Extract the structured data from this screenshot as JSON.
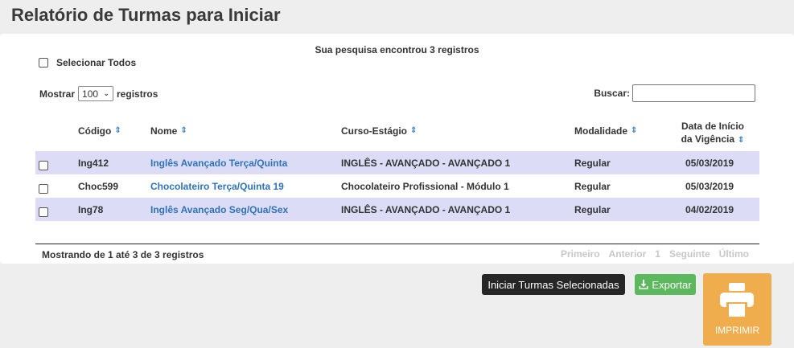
{
  "page": {
    "title": "Relatório de Turmas para Iniciar"
  },
  "summary": {
    "result_text": "Sua pesquisa encontrou 3 registros"
  },
  "select_all": {
    "label": "Selecionar Todos"
  },
  "length": {
    "prefix": "Mostrar",
    "value": "100",
    "suffix": "registros"
  },
  "search": {
    "label": "Buscar:",
    "value": ""
  },
  "table": {
    "headers": {
      "codigo": "Código",
      "nome": "Nome",
      "curso": "Curso-Estágio",
      "modalidade": "Modalidade",
      "data_line1": "Data de Início",
      "data_line2": "da Vigência"
    },
    "rows": [
      {
        "codigo": "Ing412",
        "nome": "Inglês Avançado Terça/Quinta",
        "curso": "INGLÊS - AVANÇADO - AVANÇADO 1",
        "modalidade": "Regular",
        "data": "05/03/2019"
      },
      {
        "codigo": "Choc599",
        "nome": "Chocolateiro Terça/Quinta 19",
        "curso": "Chocolateiro Profissional - Módulo 1",
        "modalidade": "Regular",
        "data": "05/03/2019"
      },
      {
        "codigo": "Ing78",
        "nome": "Inglês Avançado Seg/Qua/Sex",
        "curso": "INGLÊS - AVANÇADO - AVANÇADO 1",
        "modalidade": "Regular",
        "data": "04/02/2019"
      }
    ]
  },
  "footer": {
    "info": "Mostrando de 1 até 3 de 3 registros",
    "pager": {
      "first": "Primeiro",
      "prev": "Anterior",
      "page": "1",
      "next": "Seguinte",
      "last": "Último"
    }
  },
  "actions": {
    "start": "Iniciar Turmas Selecionadas",
    "export": "Exportar",
    "print": "IMPRIMIR"
  },
  "colors": {
    "row_alt": "#dcdcf6",
    "link": "#2f73b8",
    "sort_icon": "#2a7ac0",
    "export_button": "#5cb85c",
    "print_button": "#f0ad4e",
    "start_button": "#262626"
  },
  "icons": {
    "sort": "sort-icon",
    "export": "download-icon",
    "print": "printer-icon"
  }
}
